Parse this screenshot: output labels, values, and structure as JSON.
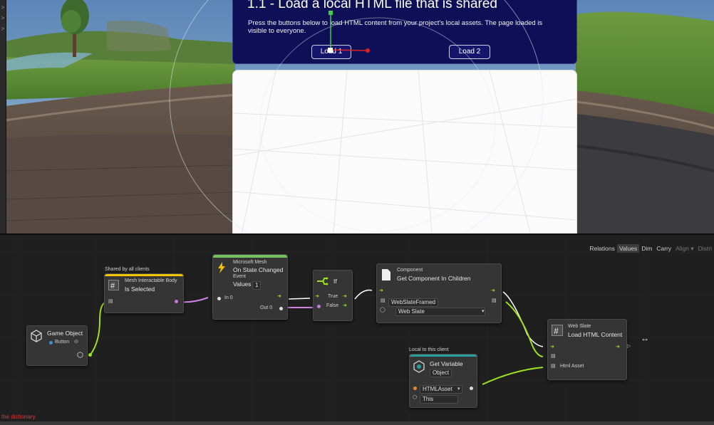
{
  "scene": {
    "panel": {
      "title": "1.1 - Load a local HTML file that is shared",
      "description": "Press the buttons below to load HTML content from your project's local assets. The page loaded is visible to everyone.",
      "button1_label": "Load 1",
      "button2_label": "Load 2",
      "background": "#0e0f57"
    },
    "left_strip_icons": [
      ">",
      ">",
      ">"
    ]
  },
  "toolbar": {
    "items": [
      "Relations",
      "Values",
      "Dim",
      "Carry",
      "Align ▾",
      "Distri"
    ],
    "active": "Values"
  },
  "nodes": {
    "game_object": {
      "title": "Game Object",
      "field": "Button",
      "icon": "cube-icon"
    },
    "interactable": {
      "group_label": "Shared by all clients",
      "category": "Mesh Interactable Body",
      "title": "Is Selected",
      "accent": "#f2c500",
      "icon": "script-icon"
    },
    "on_state_changed": {
      "category": "Microsoft Mesh",
      "title": "On State Changed",
      "subtitle": "Event",
      "values_label": "Values",
      "values_count": "1",
      "in_label": "In 0",
      "out_label": "Out 0",
      "accent": "#78c05a",
      "icon": "lightning-icon"
    },
    "if_node": {
      "title": "If",
      "true_label": "True",
      "false_label": "False",
      "icon": "branch-icon"
    },
    "get_component": {
      "category": "Component",
      "title": "Get Component In Children",
      "target_field": "WebSlateFramed",
      "type_field": "Web Slate",
      "icon": "document-icon"
    },
    "get_variable": {
      "group_label": "Local to this client",
      "title": "Get Variable",
      "kind": "Object",
      "name_field": "HTMLAsset",
      "scope_field": "This",
      "accent": "#2a9d9d",
      "icon": "variable-icon"
    },
    "load_html": {
      "category": "Web Slate",
      "title": "Load HTML Content",
      "param_label": "Html Asset",
      "icon": "script-icon"
    }
  },
  "colors": {
    "flow": "#9be11f",
    "object_port": "#9be11f",
    "event_port": "#d080e0",
    "exec": "#ffffff"
  },
  "status": {
    "text": "the dictionary."
  }
}
